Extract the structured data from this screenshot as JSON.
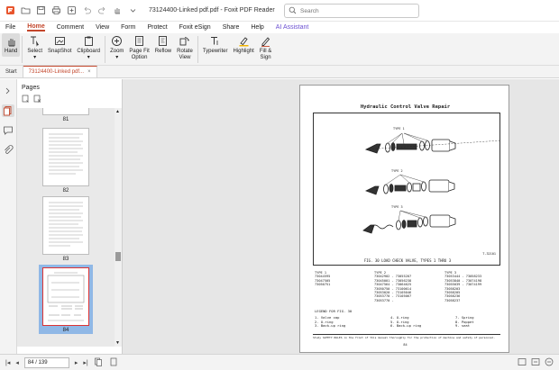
{
  "titlebar": {
    "doc_title": "73124400-Linked pdf.pdf - Foxit PDF Reader",
    "search_placeholder": "Search"
  },
  "menu": [
    "File",
    "Home",
    "Comment",
    "View",
    "Form",
    "Protect",
    "Foxit eSign",
    "Share",
    "Help",
    "AI Assistant"
  ],
  "ribbon": {
    "hand": "Hand",
    "select": "Select",
    "snapshot": "SnapShot",
    "clipboard": "Clipboard",
    "zoom": "Zoom",
    "page_fit_1": "Page Fit",
    "page_fit_2": "Option",
    "reflow": "Reflow",
    "rotate_1": "Rotate",
    "rotate_2": "View",
    "typewriter": "Typewriter",
    "highlight": "Highlight",
    "fill_sign_1": "Fill &",
    "fill_sign_2": "Sign"
  },
  "tabs": {
    "start": "Start",
    "doc": "73124400-Linked pdf...",
    "close": "×"
  },
  "pages_panel": {
    "title": "Pages",
    "thumbs": [
      "81",
      "82",
      "83",
      "84"
    ]
  },
  "document": {
    "title": "Hydraulic Control Valve Repair",
    "type1": "TYPE 1",
    "type2": "TYPE 2",
    "type3": "TYPE 3",
    "caption": "FIG. 30  LOAD CHECK VALVE, TYPES 1 THRU 3",
    "fig_code": "T-32101",
    "col1": "TYPE 1\n73044595\n73047505\n73050751",
    "col2": "TYPE 2\n73042902 - 73055207\n73045001 - 73056238\n73047564 - 73064625\n73050750 - 73100614\n73053020 - 73105046\n73053770 - 73105067\n73053770 -",
    "col3": "TYPE 3\n73053444 - 73058233\n73053840 - 73074198\n73055039 - 73074199\n73058203\n73058205\n73058236\n73058237",
    "legend_title": "LEGEND FOR FIG. 30",
    "legend": [
      "1. Valve cap",
      "2. O-ring",
      "3. Back-up ring",
      "4. O-ring",
      "5. O-ring",
      "6. Back-up ring",
      "7. Spring",
      "8. Poppet",
      "9. seat"
    ],
    "footer": "Study SAFETY RULES in the front of this manual thoroughly for the protection of machine and safety of personnel.",
    "page_num": "84"
  },
  "statusbar": {
    "page_value": "84 / 139"
  }
}
